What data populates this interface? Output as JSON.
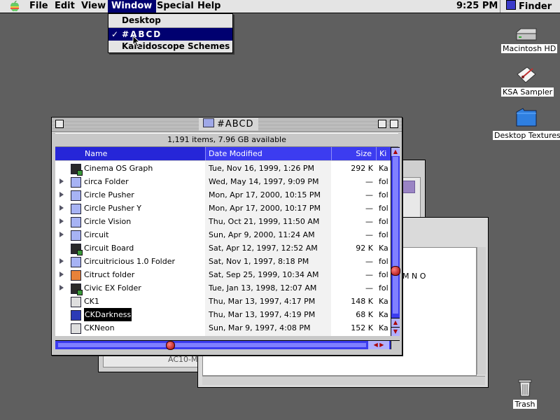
{
  "menubar": {
    "items": [
      "File",
      "Edit",
      "View",
      "Window",
      "Special",
      "Help"
    ],
    "clock": "9:25 PM",
    "app": "Finder"
  },
  "window_menu": {
    "items": [
      "Desktop",
      "#ABCD",
      "Kaleidoscope Schemes"
    ],
    "checked": "✓"
  },
  "desktop_icons": {
    "hd": "Macintosh HD",
    "ksa": "KSA Sampler",
    "textures": "Desktop Textures",
    "trash": "Trash"
  },
  "background": {
    "window1_text": "AC10-M",
    "window2_text": "M N O"
  },
  "window": {
    "title": "#ABCD",
    "info": "1,191 items, 7.96 GB available",
    "columns": {
      "name": "Name",
      "date": "Date Modified",
      "size": "Size",
      "kind": "Ki"
    },
    "rows": [
      {
        "name": "Cinema OS Graph",
        "date": "Tue, Nov 16, 1999, 1:26 PM",
        "size": "292 K",
        "kind": "Ka",
        "icon": "app",
        "folder": false
      },
      {
        "name": "circa Folder",
        "date": "Wed, May 14, 1997, 9:09 PM",
        "size": "—",
        "kind": "fol",
        "icon": "folder",
        "folder": true
      },
      {
        "name": "Circle Pusher",
        "date": "Mon, Apr 17, 2000, 10:15 PM",
        "size": "—",
        "kind": "fol",
        "icon": "folder",
        "folder": true
      },
      {
        "name": "Circle Pusher Y",
        "date": "Mon, Apr 17, 2000, 10:17 PM",
        "size": "—",
        "kind": "fol",
        "icon": "folder",
        "folder": true
      },
      {
        "name": "Circle Vision",
        "date": "Thu, Oct 21, 1999, 11:50 AM",
        "size": "—",
        "kind": "fol",
        "icon": "folder",
        "folder": true
      },
      {
        "name": "Circuit",
        "date": "Sun, Apr 9, 2000, 11:24 AM",
        "size": "—",
        "kind": "fol",
        "icon": "folder",
        "folder": true
      },
      {
        "name": "Circuit Board",
        "date": "Sat, Apr 12, 1997, 12:52 AM",
        "size": "92 K",
        "kind": "Ka",
        "icon": "app",
        "folder": false
      },
      {
        "name": "Circuitricious 1.0 Folder",
        "date": "Sat, Nov 1, 1997, 8:18 PM",
        "size": "—",
        "kind": "fol",
        "icon": "folder",
        "folder": true
      },
      {
        "name": "Citruct folder",
        "date": "Sat, Sep 25, 1999, 10:34 AM",
        "size": "—",
        "kind": "fol",
        "icon": "orangefolder",
        "folder": true
      },
      {
        "name": "Civic EX Folder",
        "date": "Tue, Jan 13, 1998, 12:07 AM",
        "size": "—",
        "kind": "fol",
        "icon": "app",
        "folder": true
      },
      {
        "name": "CK1",
        "date": "Thu, Mar 13, 1997, 4:17 PM",
        "size": "148 K",
        "kind": "Ka",
        "icon": "doc",
        "folder": false
      },
      {
        "name": "CKDarkness",
        "date": "Thu, Mar 13, 1997, 4:19 PM",
        "size": "68 K",
        "kind": "Ka",
        "icon": "blue",
        "folder": false,
        "selected": true
      },
      {
        "name": "CKNeon",
        "date": "Sun, Mar 9, 1997, 4:08 PM",
        "size": "152 K",
        "kind": "Ka",
        "icon": "doc",
        "folder": false
      }
    ]
  },
  "colors": {
    "desktop": "#5f5f5f",
    "menu_highlight": "#000070",
    "list_header": "#3c3cf0"
  }
}
